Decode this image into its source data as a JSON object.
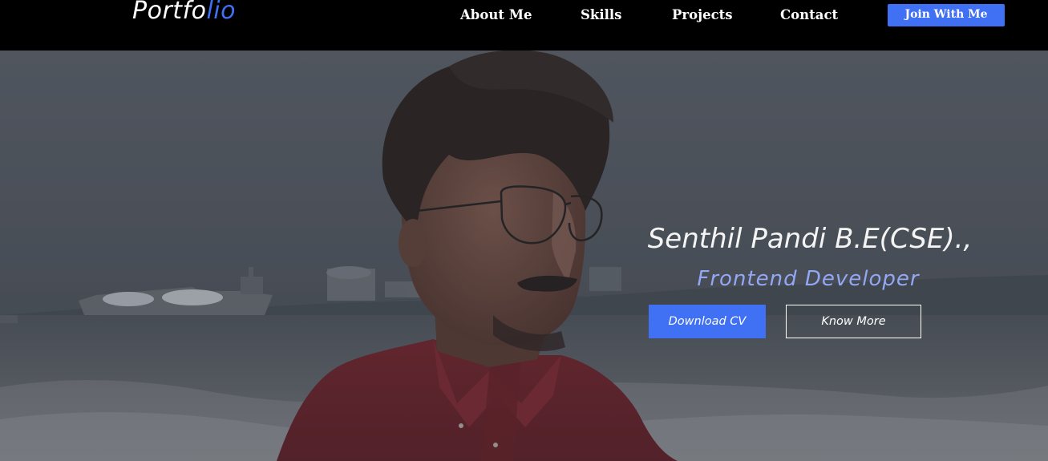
{
  "nav": {
    "logo_main": "Portfo",
    "logo_accent": "lio",
    "links": {
      "about": "About Me",
      "skills": "Skills",
      "projects": "Projects",
      "contact": "Contact"
    },
    "join_label": "Join With Me"
  },
  "hero": {
    "name": "Senthil Pandi B.E(CSE).,",
    "role": "Frontend Developer",
    "download_label": "Download CV",
    "more_label": "Know More"
  },
  "colors": {
    "accent": "#4070f4",
    "role_text": "#93a8f4",
    "nav_background": "#000000",
    "hero_overlay": "#3a3f47"
  }
}
